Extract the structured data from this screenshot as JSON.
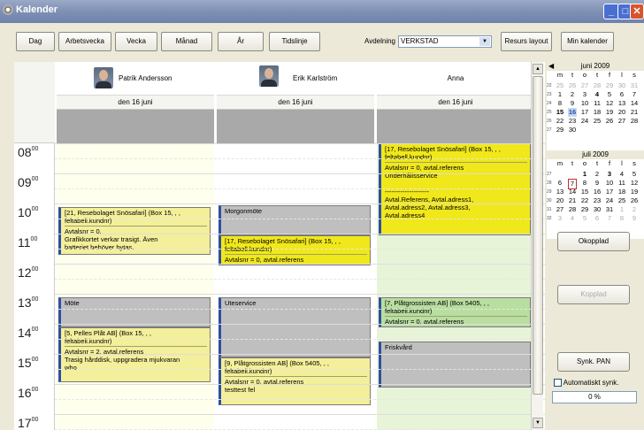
{
  "window": {
    "title": "Kalender"
  },
  "toolbar": {
    "views": [
      "Dag",
      "Arbetsvecka",
      "Vecka",
      "Månad",
      "År",
      "Tidslinje"
    ],
    "department_label": "Avdelning",
    "department_value": "VERKSTAD",
    "resource_layout": "Resurs layout",
    "my_calendar": "Min kalender"
  },
  "times": [
    {
      "hour": "08",
      "min": "00"
    },
    {
      "hour": "09",
      "min": "00"
    },
    {
      "hour": "10",
      "min": "00"
    },
    {
      "hour": "11",
      "min": "00"
    },
    {
      "hour": "12",
      "min": "00"
    },
    {
      "hour": "13",
      "min": "00"
    },
    {
      "hour": "14",
      "min": "00"
    },
    {
      "hour": "15",
      "min": "00"
    },
    {
      "hour": "16",
      "min": "00"
    },
    {
      "hour": "17",
      "min": "00"
    }
  ],
  "resources": [
    {
      "name": "Patrik Andersson",
      "date": "den 16 juni"
    },
    {
      "name": "Erik Karlström",
      "date": "den 16 juni"
    },
    {
      "name": "Anna",
      "date": "den 16 juni"
    }
  ],
  "events": {
    "patrik": [
      {
        "l1": "[21, Resebolaget Snösafari] (Box 15, , ,",
        "l2": "feltabell.kundnr)",
        "l3": "Avtalsnr = 0,",
        "l4": "Grafikkortet verkar trasigt. Även",
        "l5": "batteriet behöver bytas.",
        "l6": "--------------------",
        "l7": ", , , ,"
      },
      {
        "l1": "Möte"
      },
      {
        "l1": "[5, Pelles Plåt AB] (Box 15, , ,",
        "l2": "feltabell.kundnr)",
        "l3": "Avtalsnr = 2, avtal.referens",
        "l4": "Trasig hårddisk, uppgradera mjukvaran",
        "l5": "who"
      }
    ],
    "erik": [
      {
        "l1": "Morgonmöte"
      },
      {
        "l1": "[17, Resebolaget Snösafari] (Box 15, , ,",
        "l2": "feltabell.kundnr)",
        "l3": "Avtalsnr = 0, avtal.referens"
      },
      {
        "l1": "Uteservice"
      },
      {
        "l1": "[9, Plåtgrossisten AB] (Box 5405, , ,",
        "l2": "feltabell.kundnr)",
        "l3": "Avtalsnr = 0, avtal.referens",
        "l4": "testtest fel"
      }
    ],
    "anna": [
      {
        "l1": "[17, Resebolaget Snösafari] (Box 15, , ,",
        "l2": "feltabell.kundnr)",
        "l3": "Avtalsnr = 0, avtal.referens",
        "l4": "Underhållsservice",
        "l5": "--------------------",
        "l6": "Avtal.Referens, Avtal.adress1,",
        "l7": "Avtal.adress2, Avtal.adress3,",
        "l8": "Avtal.adress4"
      },
      {
        "l1": "[7, Plåtgrossisten AB] (Box 5405, , ,",
        "l2": "feltabell.kundnr)",
        "l3": "Avtalsnr = 0, avtal.referens"
      },
      {
        "l1": "Friskvård"
      }
    ]
  },
  "mini_calendar": {
    "weekday_headers": [
      "m",
      "t",
      "o",
      "t",
      "f",
      "l",
      "s"
    ],
    "june": {
      "title": "juni 2009",
      "weeks": [
        {
          "wk": "22",
          "days": [
            "25",
            "26",
            "27",
            "28",
            "29",
            "30",
            "31"
          ]
        },
        {
          "wk": "23",
          "days": [
            "1",
            "2",
            "3",
            "4",
            "5",
            "6",
            "7"
          ]
        },
        {
          "wk": "24",
          "days": [
            "8",
            "9",
            "10",
            "11",
            "12",
            "13",
            "14"
          ]
        },
        {
          "wk": "25",
          "days": [
            "15",
            "16",
            "17",
            "18",
            "19",
            "20",
            "21"
          ]
        },
        {
          "wk": "26",
          "days": [
            "22",
            "23",
            "24",
            "25",
            "26",
            "27",
            "28"
          ]
        },
        {
          "wk": "27",
          "days": [
            "29",
            "30",
            "",
            "",
            "",
            "",
            ""
          ]
        }
      ]
    },
    "july": {
      "title": "juli 2009",
      "weeks": [
        {
          "wk": "27",
          "days": [
            "",
            "",
            "1",
            "2",
            "3",
            "4",
            "5"
          ]
        },
        {
          "wk": "28",
          "days": [
            "6",
            "7",
            "8",
            "9",
            "10",
            "11",
            "12"
          ]
        },
        {
          "wk": "29",
          "days": [
            "13",
            "14",
            "15",
            "16",
            "17",
            "18",
            "19"
          ]
        },
        {
          "wk": "30",
          "days": [
            "20",
            "21",
            "22",
            "23",
            "24",
            "25",
            "26"
          ]
        },
        {
          "wk": "31",
          "days": [
            "27",
            "28",
            "29",
            "30",
            "31",
            "1",
            "2"
          ]
        },
        {
          "wk": "32",
          "days": [
            "3",
            "4",
            "5",
            "6",
            "7",
            "8",
            "9"
          ]
        }
      ]
    }
  },
  "side": {
    "okopplad": "Okopplad",
    "kopplad": "Kopplad",
    "sync": "Synk. PAN",
    "auto_sync": "Automatiskt synk.",
    "progress": "0 %"
  }
}
